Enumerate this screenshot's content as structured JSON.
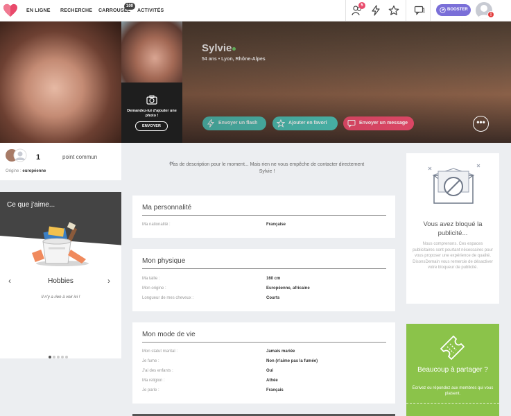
{
  "nav": {
    "links": [
      "EN LIGNE",
      "RECHERCHE",
      "CARROUSEL",
      "ACTIVITÉS"
    ],
    "carrousel_badge": "100",
    "visits_badge": "5",
    "booster_label": "BOOSTER",
    "alert_badge": "!"
  },
  "profile": {
    "name": "Sylvie",
    "meta": "54 ans • Lyon,  Rhône-Alpes",
    "ask_photo_text": "Demandez-lui d'ajouter une photo !",
    "ask_button": "ENVOYER",
    "actions": {
      "flash": "Envoyer un flash",
      "favori": "Ajouter en favori",
      "message": "Envoyer un message"
    },
    "more": "•••"
  },
  "common": {
    "count": "1",
    "label": "point commun",
    "origin_label": "Origine :",
    "origin_value": "européenne"
  },
  "likes": {
    "title": "Ce que j'aime...",
    "category": "Hobbies",
    "empty": "Il n'y a rien à voir ici !",
    "prev": "‹",
    "next": "›"
  },
  "description": "Pas de description pour le moment... Mais rien ne vous empêche de contacter directement Sylvie !",
  "sections": {
    "personnalite": {
      "title": "Ma personnalité",
      "rows": [
        {
          "label": "Ma nationalité :",
          "value": "Française"
        }
      ]
    },
    "physique": {
      "title": "Mon physique",
      "rows": [
        {
          "label": "Ma taille :",
          "value": "160 cm"
        },
        {
          "label": "Mon origine :",
          "value": "Européenne, africaine"
        },
        {
          "label": "Longueur de mes cheveux :",
          "value": "Courts"
        }
      ]
    },
    "mode_de_vie": {
      "title": "Mon mode de vie",
      "rows": [
        {
          "label": "Mon statut marital :",
          "value": "Jamais mariée"
        },
        {
          "label": "Je fume :",
          "value": "Non (n'aime pas la fumée)"
        },
        {
          "label": "J'ai des enfants :",
          "value": "Oui"
        },
        {
          "label": "Ma religion :",
          "value": "Athée"
        },
        {
          "label": "Je parle :",
          "value": "Français"
        }
      ]
    }
  },
  "adblock": {
    "title": "Vous avez bloqué la publicité...",
    "text": "Nous comprenons. Ces espaces publicitaires sont pourtant nécessaires pour vous proposer une expérience de qualité. DisonsDemain vous remercie de désactiver votre bloqueur de publicité."
  },
  "share": {
    "title": "Beaucoup à partager ?",
    "text": "Écrivez ou répondez aux membres qui vous plaisent."
  },
  "colors": {
    "flash": "#4bc4b8",
    "favori": "#4bc4b8",
    "message": "#e94a6b",
    "booster": "#7a6fd8",
    "share": "#8bc34a"
  }
}
